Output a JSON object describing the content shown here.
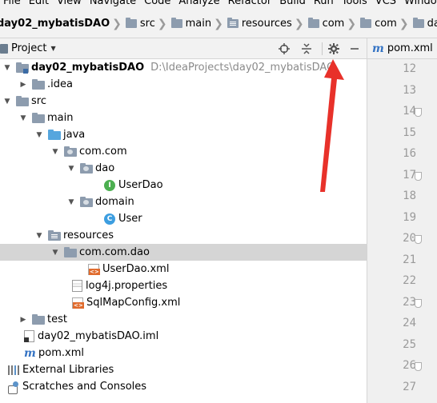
{
  "menu": [
    "File",
    "Edit",
    "View",
    "Navigate",
    "Code",
    "Analyze",
    "Refactor",
    "Build",
    "Run",
    "Tools",
    "VCS",
    "Window"
  ],
  "breadcrumb": [
    "day02_mybatisDAO",
    "src",
    "main",
    "resources",
    "com",
    "com",
    "dao"
  ],
  "project_panel": {
    "title": "Project",
    "tools": [
      "locate-icon",
      "collapse-icon",
      "gear-icon",
      "minimize-icon"
    ]
  },
  "editor": {
    "tab_label": "pom.xml",
    "line_numbers": [
      "12",
      "13",
      "14",
      "15",
      "16",
      "17",
      "18",
      "19",
      "20",
      "21",
      "22",
      "23",
      "24",
      "25",
      "26",
      "27"
    ]
  },
  "tree": {
    "root": {
      "label": "day02_mybatisDAO",
      "path": "D:\\IdeaProjects\\day02_mybatisDAO"
    },
    "idea": ".idea",
    "src": "src",
    "main": "main",
    "java": "java",
    "com_com": "com.com",
    "dao": "dao",
    "user_dao": "UserDao",
    "domain": "domain",
    "user": "User",
    "resources": "resources",
    "com_com_dao": "com.com.dao",
    "user_dao_xml": "UserDao.xml",
    "log4j": "log4j.properties",
    "sqlmap": "SqlMapConfig.xml",
    "test": "test",
    "iml": "day02_mybatisDAO.iml",
    "pom": "pom.xml",
    "ext_libs": "External Libraries",
    "scratches": "Scratches and Consoles"
  },
  "icon_letters": {
    "interface": "I",
    "class": "C",
    "maven": "m"
  },
  "colors": {
    "annotation_arrow": "#e8312a",
    "selection": "#d5d5d5",
    "folder_blue": "#56a6de"
  }
}
